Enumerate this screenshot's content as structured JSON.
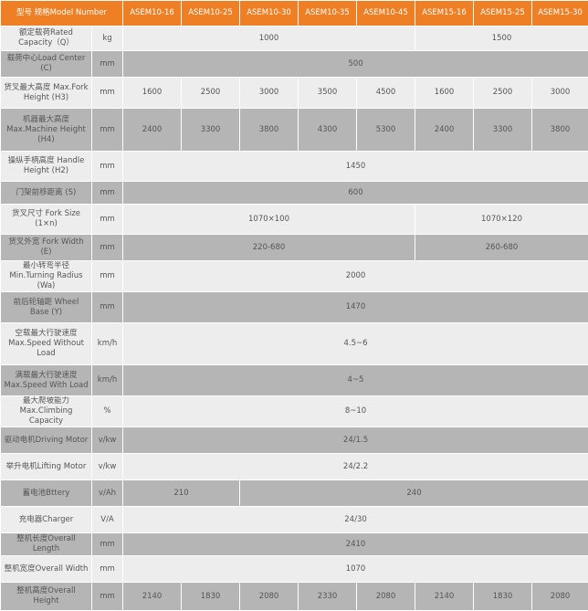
{
  "colors": {
    "header_bg": "#ef7f24",
    "row_light": "#ededed",
    "row_dark": "#b5b5b5",
    "text": "#555555"
  },
  "header": {
    "label": "型号 规格Model Number",
    "models": [
      "ASEM10-16",
      "ASEM10-25",
      "ASEM10-30",
      "ASEM10-35",
      "ASEM10-45",
      "ASEM15-16",
      "ASEM15-25",
      "ASEM15-30"
    ]
  },
  "rows": [
    {
      "label": "额定载荷Rated Capacity（Q）",
      "unit": "kg",
      "cells": [
        {
          "v": "1000",
          "span": 5
        },
        {
          "v": "1500",
          "span": 3
        }
      ]
    },
    {
      "label": "载荷中心Load Center (C)",
      "unit": "mm",
      "cells": [
        {
          "v": "500",
          "span": 8
        }
      ]
    },
    {
      "label": "货叉最大高度 Max.Fork Height (H3)",
      "unit": "mm",
      "cells": [
        {
          "v": "1600",
          "span": 1
        },
        {
          "v": "2500",
          "span": 1
        },
        {
          "v": "3000",
          "span": 1
        },
        {
          "v": "3500",
          "span": 1
        },
        {
          "v": "4500",
          "span": 1
        },
        {
          "v": "1600",
          "span": 1
        },
        {
          "v": "2500",
          "span": 1
        },
        {
          "v": "3000",
          "span": 1
        }
      ]
    },
    {
      "label": "机器最大高度 Max.Machine Height (H4)",
      "unit": "mm",
      "cells": [
        {
          "v": "2400",
          "span": 1
        },
        {
          "v": "3300",
          "span": 1
        },
        {
          "v": "3800",
          "span": 1
        },
        {
          "v": "4300",
          "span": 1
        },
        {
          "v": "5300",
          "span": 1
        },
        {
          "v": "2400",
          "span": 1
        },
        {
          "v": "3300",
          "span": 1
        },
        {
          "v": "3800",
          "span": 1
        }
      ]
    },
    {
      "label": "操纵手柄高度 Handle Height (H2)",
      "unit": "mm",
      "cells": [
        {
          "v": "1450",
          "span": 8
        }
      ]
    },
    {
      "label": "门架前移距离 (S)",
      "unit": "mm",
      "cells": [
        {
          "v": "600",
          "span": 8
        }
      ]
    },
    {
      "label": "货叉尺寸 Fork Size (1×n)",
      "unit": "mm",
      "cells": [
        {
          "v": "1070×100",
          "span": 5
        },
        {
          "v": "1070×120",
          "span": 3
        }
      ]
    },
    {
      "label": "货叉外宽 Fork Width (E)",
      "unit": "mm",
      "cells": [
        {
          "v": "220-680",
          "span": 5
        },
        {
          "v": "260-680",
          "span": 3
        }
      ]
    },
    {
      "label": "最小转弯半径 Min.Turning Radius (Wa)",
      "unit": "mm",
      "cells": [
        {
          "v": "2000",
          "span": 8
        }
      ]
    },
    {
      "label": "前后轮轴距 Wheel Base (Y)",
      "unit": "mm",
      "cells": [
        {
          "v": "1470",
          "span": 8
        }
      ]
    },
    {
      "label": "空载最大行驶速度 Max.Speed Without Load",
      "unit": "km/h",
      "cells": [
        {
          "v": "4.5~6",
          "span": 8
        }
      ]
    },
    {
      "label": "满载最大行驶速度 Max.Speed With Load",
      "unit": "km/h",
      "cells": [
        {
          "v": "4~5",
          "span": 8
        }
      ]
    },
    {
      "label": "最大爬坡能力 Max.Climbing Capacity",
      "unit": "%",
      "cells": [
        {
          "v": "8~10",
          "span": 8
        }
      ]
    },
    {
      "label": "驱动电机Driving Motor",
      "unit": "v/kw",
      "cells": [
        {
          "v": "24/1.5",
          "span": 8
        }
      ]
    },
    {
      "label": "举升电机Lifting Motor",
      "unit": "v/kw",
      "cells": [
        {
          "v": "24/2.2",
          "span": 8
        }
      ]
    },
    {
      "label": "蓄电池Bttery",
      "unit": "v/Ah",
      "cells": [
        {
          "v": "210",
          "span": 2
        },
        {
          "v": "240",
          "span": 6
        }
      ]
    },
    {
      "label": "充电器Charger",
      "unit": "V/A",
      "cells": [
        {
          "v": "24/30",
          "span": 8
        }
      ]
    },
    {
      "label": "整机长度Overall Length",
      "unit": "mm",
      "cells": [
        {
          "v": "2410",
          "span": 8
        }
      ]
    },
    {
      "label": "整机宽度Overall Width",
      "unit": "mm",
      "cells": [
        {
          "v": "1070",
          "span": 8
        }
      ]
    },
    {
      "label": "整机高度Overall Height",
      "unit": "mm",
      "cells": [
        {
          "v": "2140",
          "span": 1
        },
        {
          "v": "1830",
          "span": 1
        },
        {
          "v": "2080",
          "span": 1
        },
        {
          "v": "2330",
          "span": 1
        },
        {
          "v": "2080",
          "span": 1
        },
        {
          "v": "2140",
          "span": 1
        },
        {
          "v": "1830",
          "span": 1
        },
        {
          "v": "2080",
          "span": 1
        }
      ]
    }
  ]
}
